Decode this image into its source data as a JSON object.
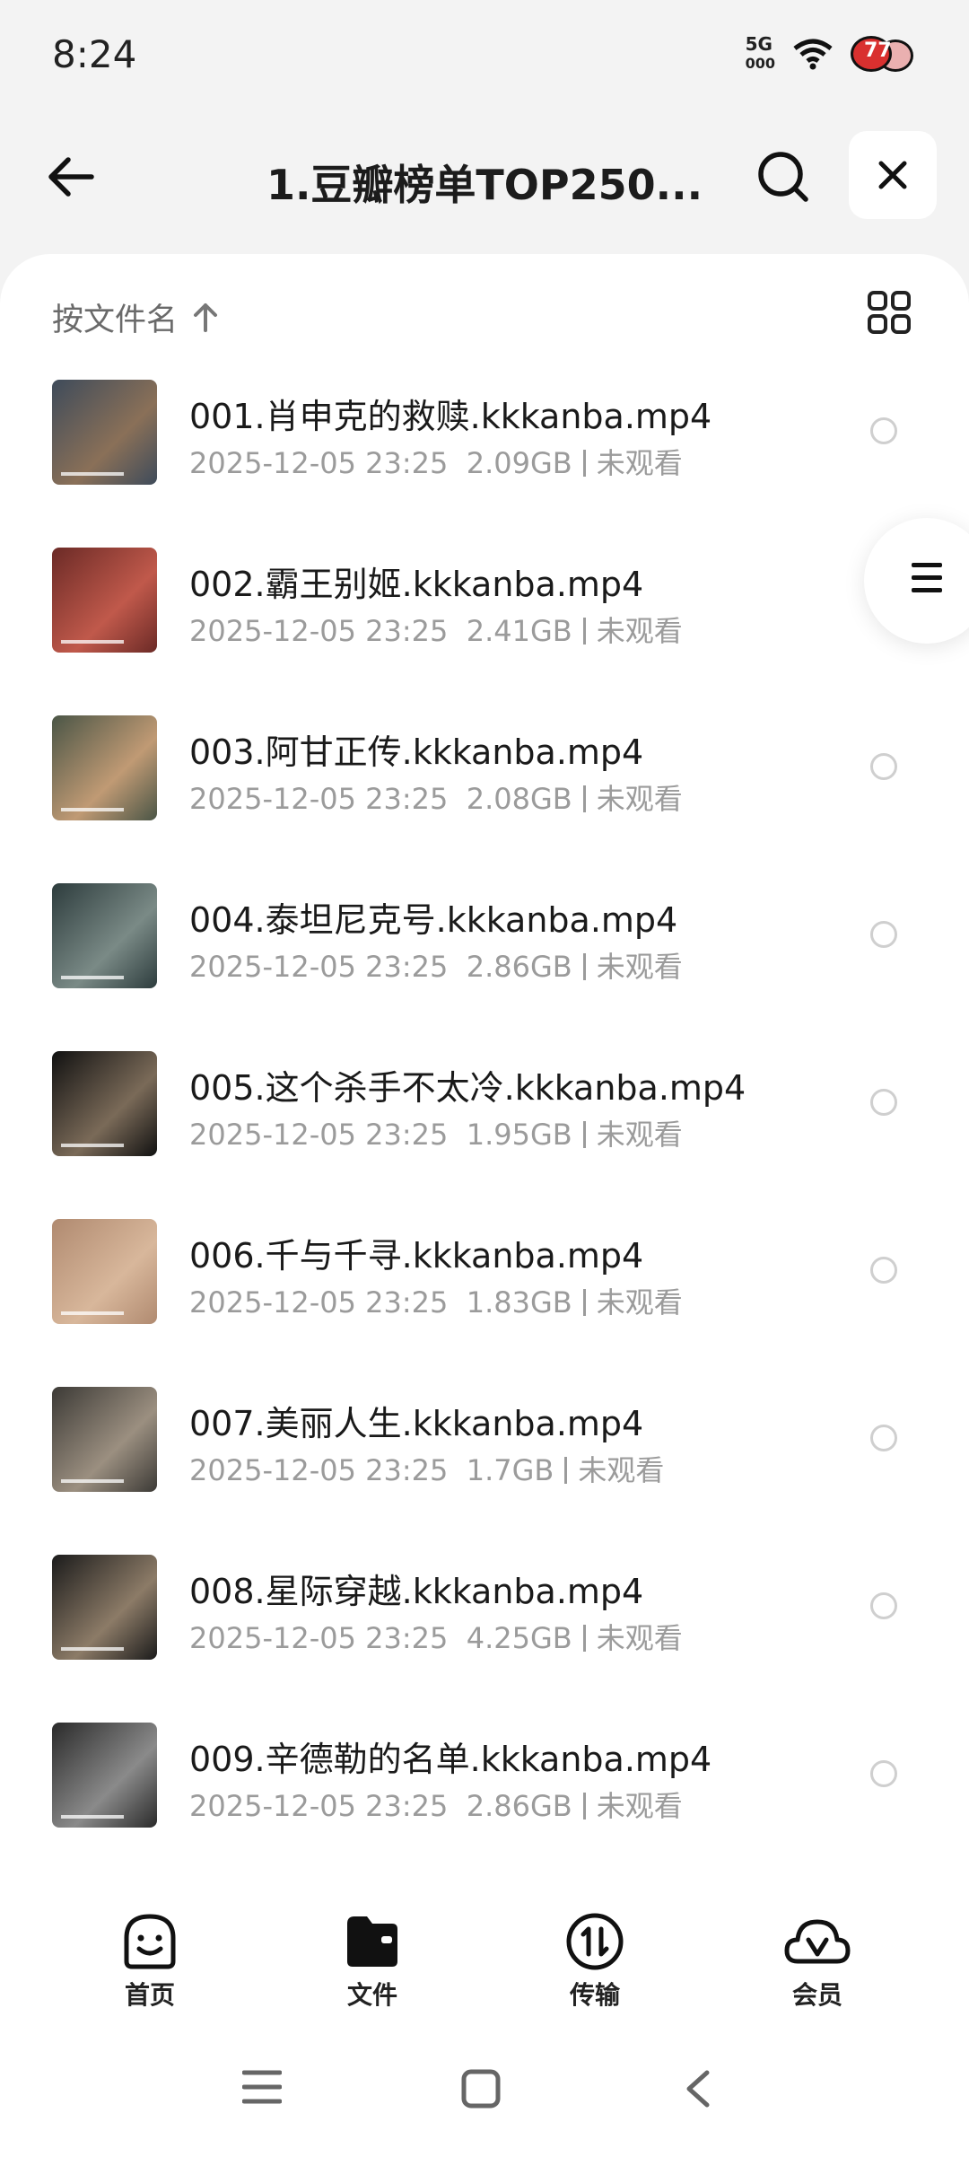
{
  "status_bar": {
    "time": "8:24",
    "network": "5G",
    "battery_level": "77"
  },
  "header": {
    "title": "1.豆瓣榜单TOP250...",
    "icons": [
      "back-arrow-icon",
      "search-icon",
      "close-icon"
    ]
  },
  "sort": {
    "label": "按文件名",
    "direction": "ascending",
    "view_icon": "grid-view-icon"
  },
  "files": [
    {
      "name": "001.肖申克的救赎.kkkanba.mp4",
      "date": "2025-12-05 23:25",
      "size": "2.09GB",
      "status": "未观看",
      "thumb_colors": [
        "#3e4b5a",
        "#8a7058"
      ]
    },
    {
      "name": "002.霸王别姬.kkkanba.mp4",
      "date": "2025-12-05 23:25",
      "size": "2.41GB",
      "status": "未观看",
      "thumb_colors": [
        "#6b2a26",
        "#c0594b"
      ]
    },
    {
      "name": "003.阿甘正传.kkkanba.mp4",
      "date": "2025-12-05 23:25",
      "size": "2.08GB",
      "status": "未观看",
      "thumb_colors": [
        "#4a5546",
        "#c09a74"
      ]
    },
    {
      "name": "004.泰坦尼克号.kkkanba.mp4",
      "date": "2025-12-05 23:25",
      "size": "2.86GB",
      "status": "未观看",
      "thumb_colors": [
        "#2d3c3d",
        "#7a8a86"
      ]
    },
    {
      "name": "005.这个杀手不太冷.kkkanba.mp4",
      "date": "2025-12-05 23:25",
      "size": "1.95GB",
      "status": "未观看",
      "thumb_colors": [
        "#111111",
        "#7a6a58"
      ]
    },
    {
      "name": "006.千与千寻.kkkanba.mp4",
      "date": "2025-12-05 23:25",
      "size": "1.83GB",
      "status": "未观看",
      "thumb_colors": [
        "#b08a70",
        "#d8b79b"
      ]
    },
    {
      "name": "007.美丽人生.kkkanba.mp4",
      "date": "2025-12-05 23:25",
      "size": "1.7GB",
      "status": "未观看",
      "thumb_colors": [
        "#3c3a36",
        "#9b8f80"
      ]
    },
    {
      "name": "008.星际穿越.kkkanba.mp4",
      "date": "2025-12-05 23:25",
      "size": "4.25GB",
      "status": "未观看",
      "thumb_colors": [
        "#1b1b1b",
        "#8c7b67"
      ]
    },
    {
      "name": "009.辛德勒的名单.kkkanba.mp4",
      "date": "2025-12-05 23:25",
      "size": "2.86GB",
      "status": "未观看",
      "thumb_colors": [
        "#2a2a2a",
        "#8a8a8a"
      ]
    }
  ],
  "bottom_nav": [
    {
      "label": "首页",
      "icon": "home-face-icon"
    },
    {
      "label": "文件",
      "icon": "folder-icon",
      "active": true
    },
    {
      "label": "传输",
      "icon": "transfer-icon"
    },
    {
      "label": "会员",
      "icon": "vip-cloud-icon"
    }
  ],
  "system_nav": {
    "icons": [
      "menu-icon",
      "home-square-icon",
      "back-chevron-icon"
    ]
  }
}
